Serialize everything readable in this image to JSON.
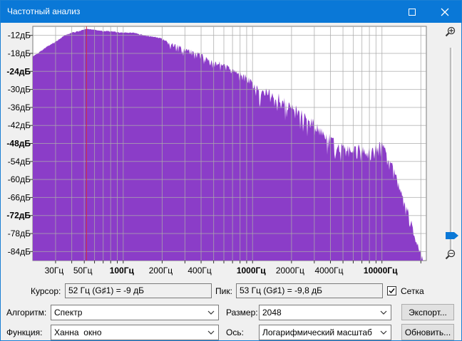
{
  "window": {
    "title": "Частотный анализ"
  },
  "colors": {
    "fill": "#8b3dc8",
    "cursor_line": "#d42a3a",
    "grid": "#ababab",
    "titlebar": "#0a78d7"
  },
  "chart_data": {
    "type": "area",
    "xscale": "log",
    "xlim": [
      20,
      22050
    ],
    "ylim": [
      -87,
      -9
    ],
    "grid": true,
    "y_ticks": [
      {
        "label": "-12дБ",
        "value": -12,
        "bold": false
      },
      {
        "label": "-18дБ",
        "value": -18,
        "bold": false
      },
      {
        "label": "-24дБ",
        "value": -24,
        "bold": true
      },
      {
        "label": "-30дБ",
        "value": -30,
        "bold": false
      },
      {
        "label": "-36дБ",
        "value": -36,
        "bold": false
      },
      {
        "label": "-42дБ",
        "value": -42,
        "bold": false
      },
      {
        "label": "-48дБ",
        "value": -48,
        "bold": true
      },
      {
        "label": "-54дБ",
        "value": -54,
        "bold": false
      },
      {
        "label": "-60дБ",
        "value": -60,
        "bold": false
      },
      {
        "label": "-66дБ",
        "value": -66,
        "bold": false
      },
      {
        "label": "-72дБ",
        "value": -72,
        "bold": true
      },
      {
        "label": "-78дБ",
        "value": -78,
        "bold": false
      },
      {
        "label": "-84дБ",
        "value": -84,
        "bold": false
      }
    ],
    "x_ticks": [
      {
        "label": "30Гц",
        "value": 30,
        "bold": false
      },
      {
        "label": "50Гц",
        "value": 50,
        "bold": false
      },
      {
        "label": "100Гц",
        "value": 100,
        "bold": true
      },
      {
        "label": "200Гц",
        "value": 200,
        "bold": false
      },
      {
        "label": "400Гц",
        "value": 400,
        "bold": false
      },
      {
        "label": "1000Гц",
        "value": 1000,
        "bold": true
      },
      {
        "label": "2000Гц",
        "value": 2000,
        "bold": false
      },
      {
        "label": "4000Гц",
        "value": 4000,
        "bold": false
      },
      {
        "label": "10000Гц",
        "value": 10000,
        "bold": true
      }
    ],
    "cursor_hz": 52,
    "x": [
      20,
      25,
      30,
      35,
      40,
      45,
      52,
      60,
      70,
      80,
      100,
      120,
      150,
      180,
      200,
      230,
      260,
      300,
      350,
      400,
      450,
      500,
      600,
      700,
      800,
      900,
      1000,
      1200,
      1400,
      1600,
      1800,
      2000,
      2300,
      2600,
      3000,
      3500,
      4000,
      4500,
      5000,
      5500,
      6000,
      6500,
      7000,
      8000,
      9000,
      10000,
      11000,
      12000,
      13000,
      14000,
      15000,
      16000,
      17000,
      18000,
      19000,
      20000,
      21000,
      22050
    ],
    "y": [
      -19,
      -16,
      -14,
      -12,
      -11,
      -10.5,
      -9.8,
      -10,
      -10.5,
      -10.5,
      -11,
      -11,
      -12,
      -12.5,
      -13,
      -14,
      -15,
      -16,
      -17,
      -18,
      -19,
      -20,
      -21,
      -23,
      -24,
      -25,
      -27,
      -29,
      -30,
      -31,
      -33,
      -34,
      -36,
      -38,
      -40,
      -43,
      -45,
      -47,
      -48,
      -48.5,
      -49,
      -48,
      -49,
      -49,
      -48,
      -47,
      -50,
      -54,
      -58,
      -62,
      -66,
      -70,
      -74,
      -78,
      -81,
      -84,
      -87,
      -87
    ]
  },
  "cursor": {
    "label": "Курсор:",
    "value": "52 Гц (G♯1) = -9 дБ"
  },
  "peak": {
    "label": "Пик:",
    "value": "53 Гц (G♯1) = -9,8 дБ"
  },
  "grid_checkbox": {
    "label": "Сетка",
    "checked": true
  },
  "algorithm": {
    "label": "Алгоритм:",
    "value": "Спектр"
  },
  "size": {
    "label": "Размер:",
    "value": "2048"
  },
  "function": {
    "label": "Функция:",
    "value": "Ханна  окно"
  },
  "axis": {
    "label": "Ось:",
    "value": "Логарифмический масштаб"
  },
  "buttons": {
    "export": "Экспорт...",
    "refresh": "Обновить..."
  }
}
